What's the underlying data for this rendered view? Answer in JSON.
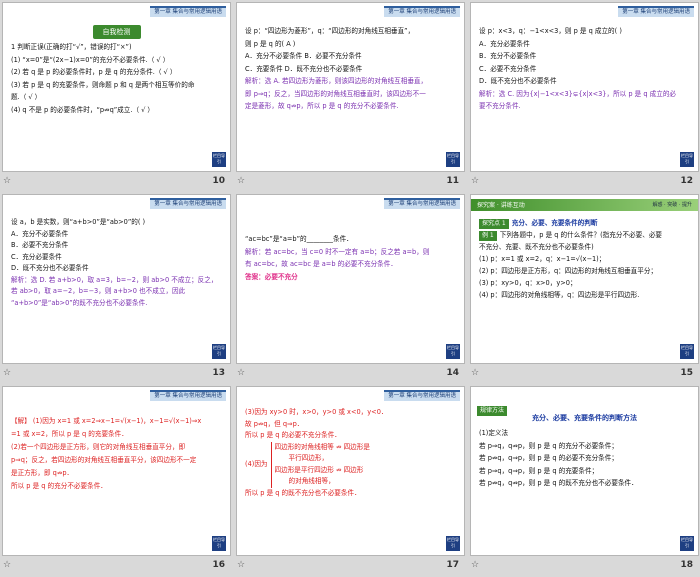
{
  "header": "第一章  集合与常用逻辑用语",
  "corner_label": "栏目导引",
  "slides": [
    {
      "number": "10",
      "badge": "自我检测",
      "lines": [
        "1  判断正误(正确的打“√”，错误的打“×”)",
        "(1) “x=0”是“(2x−1)x=0”的充分不必要条件.（ √ ）",
        "(2) 若 q 是 p 的必要条件时，p 是 q 的充分条件.（ √ ）",
        "(3) 若 p 是 q 的充要条件，则命题 p 和 q 是两个相互等价的命",
        "题.（ √ ）",
        "(4) q 不是 p 的必要条件时，“p⇏q”成立.（ √ ）"
      ]
    },
    {
      "number": "11",
      "lines": [
        "设 p：“四边形为菱形”，q：“四边形的对角线互相垂直”，",
        "则 p 是 q 的(    A    )",
        "A．充分不必要条件              B．必要不充分条件",
        "C．充要条件                      D．既不充分也不必要条件",
        "解析：选 A. 若四边形为菱形，则该四边形的对角线互相垂直，",
        "即 p⇒q；反之，当四边形的对角线互相垂直时，该四边形不一",
        "定是菱形，故 q⇏p，所以 p 是 q 的充分不必要条件."
      ]
    },
    {
      "number": "12",
      "lines": [
        "设 p：x<3，q：−1<x<3，则 p 是 q 成立的(    )",
        "A．充分必要条件",
        "B．充分不必要条件",
        "C．必要不充分条件",
        "D．既不充分也不必要条件",
        "解析：选 C. 因为{x|−1<x<3}⊊{x|x<3}，所以 p 是 q 成立的必",
        "要不充分条件."
      ]
    },
    {
      "number": "13",
      "lines": [
        "设 a，b 是实数，则“a+b>0”是“ab>0”的(    )",
        "A．充分不必要条件",
        "B．必要不充分条件",
        "C．充分必要条件",
        "D．既不充分也不必要条件",
        "解析：选 D. 若 a+b>0，取 a=3，b=−2，则 ab>0 不成立；反之，",
        "若 ab>0，取 a=−2，b=−3，则 a+b>0 也不成立，因此",
        "“a+b>0”是“ab>0”的既不充分也不必要条件."
      ]
    },
    {
      "number": "14",
      "lines": [
        "“ac=bc”是“a=b”的________条件．",
        "解析：若 ac=bc，当 c=0 时不一定有 a=b；反之若 a=b，则",
        "有 ac=bc，故 ac=bc 是 a=b 的必要不充分条件．",
        "答案：必要不充分"
      ]
    },
    {
      "number": "15",
      "tab": "探究案 · 讲练互动",
      "tab_right": "解惑 · 突破 · 提升",
      "section_label": "探究点 1",
      "section_title": "充分、必要、充要条件的判断",
      "example_label": "例 1",
      "lines": [
        "下列各题中，p 是 q 的什么条件？(指充分不必要、必要",
        "不充分、充要、既不充分也不必要条件)",
        "(1) p：x=1 或 x=2，q：x−1=√(x−1)；",
        "(2) p：四边形是正方形，q：四边形的对角线互相垂直平分；",
        "(3) p：xy>0，q：x>0，y>0；",
        "(4) p：四边形的对角线相等，q：四边形是平行四边形."
      ]
    },
    {
      "number": "16",
      "lines": [
        "【解】 (1)因为 x=1 或 x=2⇒x−1=√(x−1)，x−1=√(x−1)⇒x",
        "=1 或 x=2，所以 p 是 q 的充要条件．",
        "(2)若一个四边形是正方形，则它的对角线互相垂直平分，即",
        "p⇒q；反之，若四边形的对角线互相垂直平分，该四边形不一定",
        "是正方形，即 q⇏p．",
        "所以 p 是 q 的充分不必要条件．"
      ]
    },
    {
      "number": "17",
      "lines": [
        "(3)因为 xy>0 时，x>0，y>0 或 x<0，y<0．",
        "故 p⇏q，但 q⇒p．",
        "所以 p 是 q 的必要不充分条件．",
        "四边形的对角线相等 ⇏ 四边形是",
        "平行四边形，",
        "四边形是平行四边形 ⇏ 四边形",
        "的对角线相等，",
        "所以 p 是 q 的既不充分也不必要条件．"
      ],
      "because_label": "(4)因为"
    },
    {
      "number": "18",
      "title_box": "规律方法",
      "subtitle": "充分、必要、充要条件的判断方法",
      "lines": [
        "(1)定义法",
        "若 p⇒q，q⇏p，则 p 是 q 的充分不必要条件；",
        "若 p⇏q，q⇒p，则 p 是 q 的必要不充分条件；",
        "若 p⇒q，q⇒p，则 p 是 q 的充要条件；",
        "若 p⇏q，q⇏p，则 p 是 q 的既不充分也不必要条件．"
      ]
    }
  ]
}
